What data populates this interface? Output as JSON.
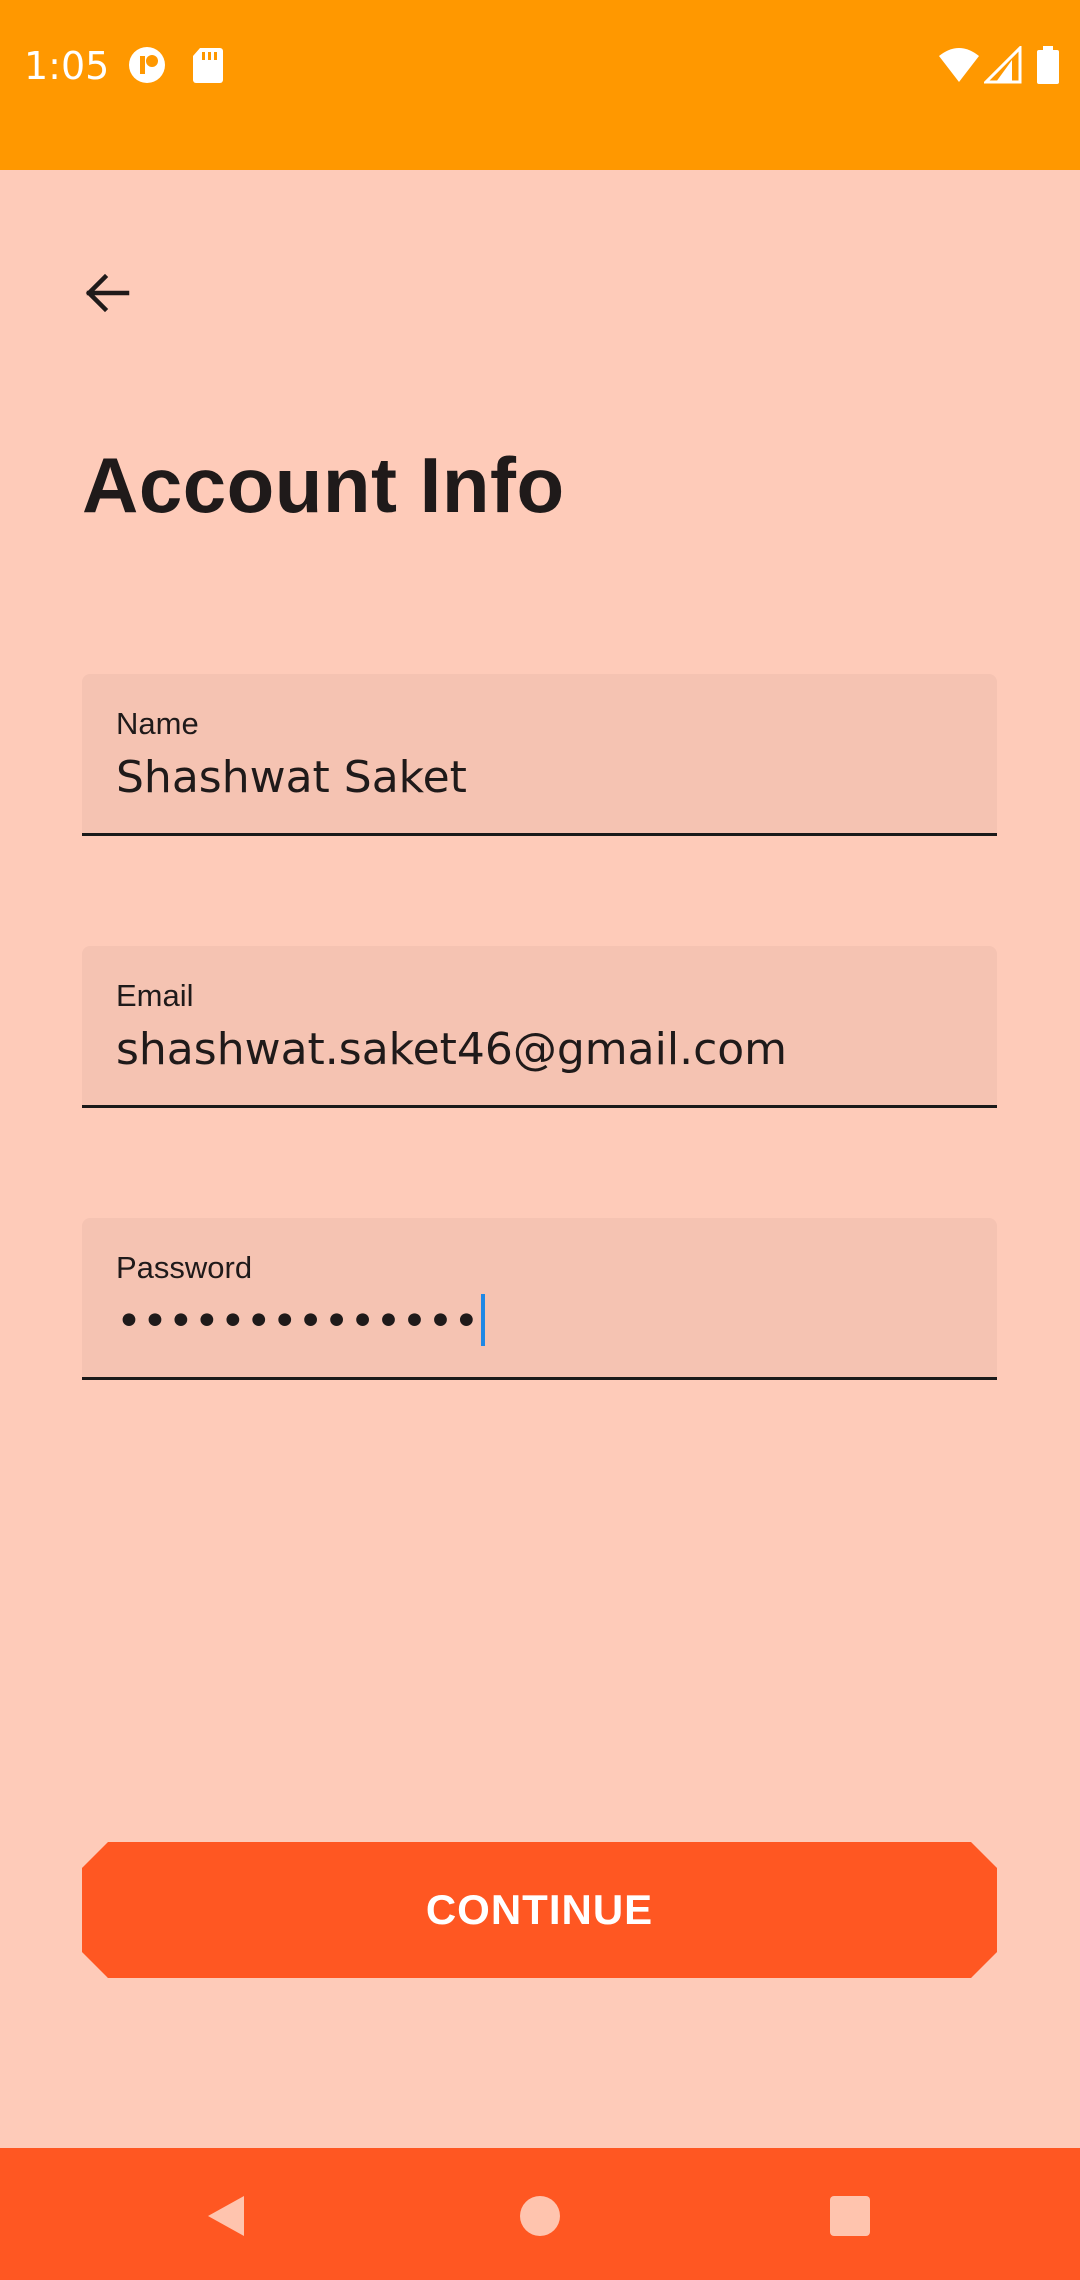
{
  "status_bar": {
    "time": "1:05",
    "icons": [
      "app-notification-icon",
      "sd-card-icon",
      "wifi-icon",
      "cell-signal-icon",
      "battery-icon"
    ],
    "background": "#FF9800"
  },
  "header": {
    "back_icon": "arrow-back-icon"
  },
  "page": {
    "title": "Account Info",
    "background": "#FECBB9"
  },
  "form": {
    "name": {
      "label": "Name",
      "value": "Shashwat Saket"
    },
    "email": {
      "label": "Email",
      "value": "shashwat.saket46@gmail.com"
    },
    "password": {
      "label": "Password",
      "value": "••••••••••••••"
    }
  },
  "actions": {
    "continue_label": "CONTINUE",
    "accent": "#FF5722"
  },
  "nav_bar": {
    "icons": [
      "nav-back-icon",
      "nav-home-icon",
      "nav-recents-icon"
    ]
  }
}
